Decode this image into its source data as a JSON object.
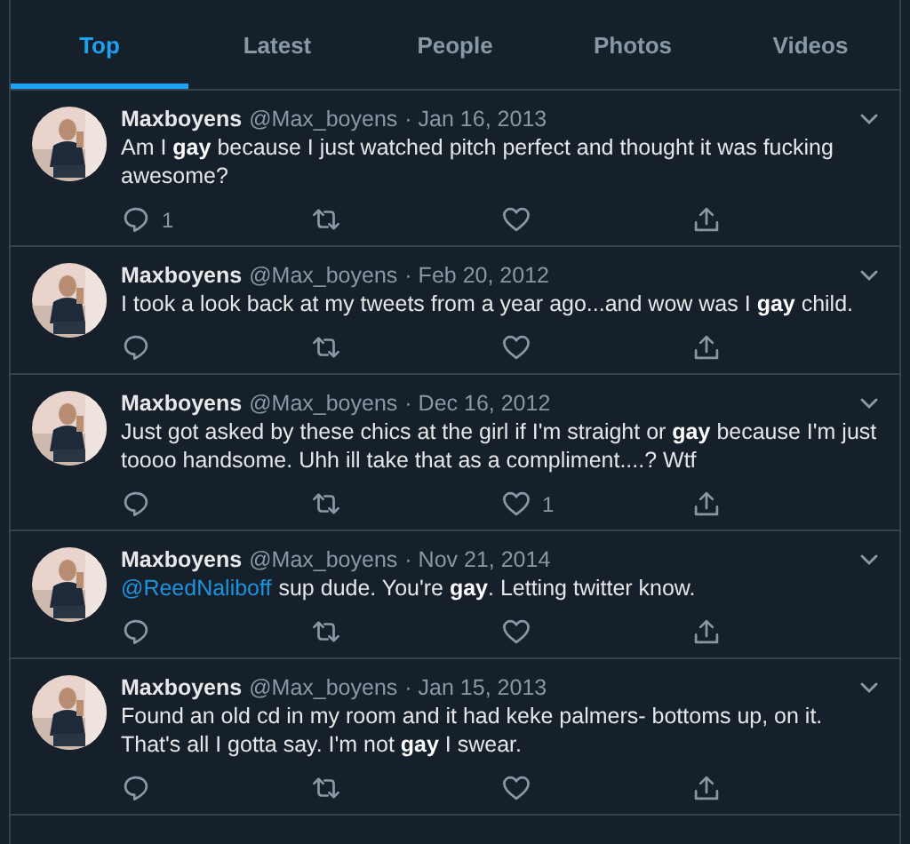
{
  "tabs": [
    {
      "label": "Top",
      "selected": true
    },
    {
      "label": "Latest",
      "selected": false
    },
    {
      "label": "People",
      "selected": false
    },
    {
      "label": "Photos",
      "selected": false
    },
    {
      "label": "Videos",
      "selected": false
    }
  ],
  "tweets": [
    {
      "name": "Maxboyens",
      "handle": "@Max_boyens",
      "date": "· Jan 16, 2013",
      "text": "Am I **gay** because I just watched pitch perfect and thought it was fucking awesome?",
      "replies": "1"
    },
    {
      "name": "Maxboyens",
      "handle": "@Max_boyens",
      "date": "· Feb 20, 2012",
      "text": "I took a look back at my tweets from a year ago...and wow was I **gay** child."
    },
    {
      "name": "Maxboyens",
      "handle": "@Max_boyens",
      "date": "· Dec 16, 2012",
      "text": "Just got asked by these chics at the girl if I'm straight or **gay** because I'm just toooo handsome. Uhh ill take that as a compliment....? Wtf",
      "likes": "1"
    },
    {
      "name": "Maxboyens",
      "handle": "@Max_boyens",
      "date": "· Nov 21, 2014",
      "mention": "@ReedNaliboff",
      "text": "sup dude. You're **gay**. Letting twitter know."
    },
    {
      "name": "Maxboyens",
      "handle": "@Max_boyens",
      "date": "· Jan 15, 2013",
      "text": "Found an old cd in my room and it had keke palmers- bottoms up, on it. That's all I gotta say. I'm not **gay** I swear."
    }
  ]
}
